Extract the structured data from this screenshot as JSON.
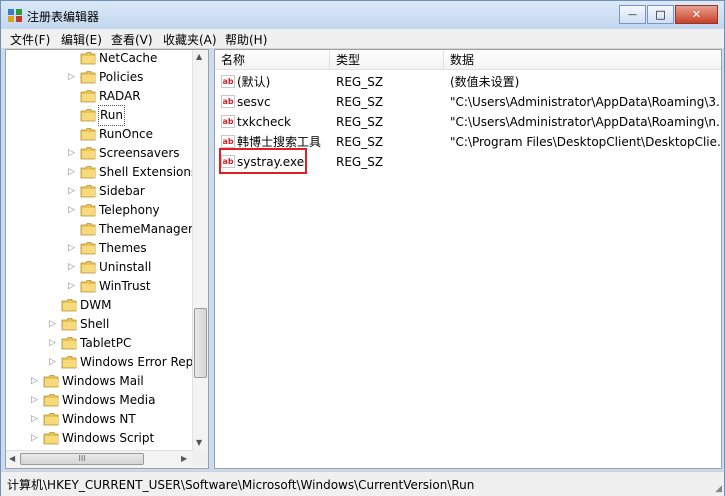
{
  "window": {
    "title": "注册表编辑器",
    "buttons": {
      "minimize": "—",
      "maximize": "□",
      "close": "✕"
    }
  },
  "menu": [
    "文件(F)",
    "编辑(E)",
    "查看(V)",
    "收藏夹(A)",
    "帮助(H)"
  ],
  "tree": {
    "items": [
      {
        "label": "NetCache",
        "expandable": false
      },
      {
        "label": "Policies",
        "expandable": true
      },
      {
        "label": "RADAR",
        "expandable": false
      },
      {
        "label": "Run",
        "expandable": false,
        "selected": true
      },
      {
        "label": "RunOnce",
        "expandable": false
      },
      {
        "label": "Screensavers",
        "expandable": true
      },
      {
        "label": "Shell Extensions",
        "expandable": true
      },
      {
        "label": "Sidebar",
        "expandable": true
      },
      {
        "label": "Telephony",
        "expandable": true
      },
      {
        "label": "ThemeManager",
        "expandable": false
      },
      {
        "label": "Themes",
        "expandable": true
      },
      {
        "label": "Uninstall",
        "expandable": true
      },
      {
        "label": "WinTrust",
        "expandable": true
      },
      {
        "label": "DWM",
        "expandable": false
      },
      {
        "label": "Shell",
        "expandable": true
      },
      {
        "label": "TabletPC",
        "expandable": true
      },
      {
        "label": "Windows Error Repo",
        "expandable": true
      },
      {
        "label": "Windows Mail",
        "expandable": true
      },
      {
        "label": "Windows Media",
        "expandable": true
      },
      {
        "label": "Windows NT",
        "expandable": true
      },
      {
        "label": "Windows Script",
        "expandable": true
      }
    ],
    "hscroll_grip": "III"
  },
  "columns": {
    "name": "名称",
    "type": "类型",
    "data": "数据"
  },
  "values": [
    {
      "name": "(默认)",
      "type": "REG_SZ",
      "data": "(数值未设置)"
    },
    {
      "name": "sesvc",
      "type": "REG_SZ",
      "data": "\"C:\\Users\\Administrator\\AppData\\Roaming\\3..."
    },
    {
      "name": "txkcheck",
      "type": "REG_SZ",
      "data": "\"C:\\Users\\Administrator\\AppData\\Roaming\\n..."
    },
    {
      "name": "韩博士搜索工具",
      "type": "REG_SZ",
      "data": "\"C:\\Program Files\\DesktopClient\\DesktopClie..."
    },
    {
      "name": "systray.exe",
      "type": "REG_SZ",
      "data": ""
    }
  ],
  "value_icon_text": "ab",
  "status": "计算机\\HKEY_CURRENT_USER\\Software\\Microsoft\\Windows\\CurrentVersion\\Run",
  "colors": {
    "accent": "#c9dcf2",
    "highlight": "#e02020",
    "close": "#c8412a"
  }
}
